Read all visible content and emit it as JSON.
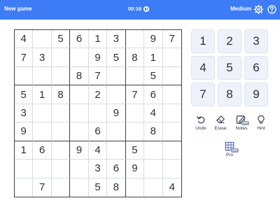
{
  "header": {
    "new_game_label": "New game",
    "timer": "00:16",
    "difficulty": "Medium",
    "accent_color": "#3d7cf5"
  },
  "board": {
    "grid": [
      [
        "4",
        "",
        "5",
        "6",
        "1",
        "3",
        "",
        "9",
        "7"
      ],
      [
        "7",
        "3",
        "",
        "",
        "9",
        "5",
        "8",
        "1",
        ""
      ],
      [
        "",
        "",
        "",
        "8",
        "7",
        "",
        "",
        "5",
        ""
      ],
      [
        "5",
        "1",
        "8",
        "",
        "2",
        "",
        "7",
        "6",
        ""
      ],
      [
        "3",
        "",
        "",
        "",
        "",
        "9",
        "",
        "4",
        ""
      ],
      [
        "9",
        "",
        "",
        "",
        "6",
        "",
        "",
        "8",
        ""
      ],
      [
        "1",
        "6",
        "",
        "9",
        "4",
        "",
        "5",
        "",
        ""
      ],
      [
        "",
        "",
        "",
        "",
        "3",
        "6",
        "9",
        "",
        ""
      ],
      [
        "",
        "7",
        "",
        "",
        "5",
        "8",
        "",
        "",
        "4"
      ]
    ]
  },
  "numpad": [
    "1",
    "2",
    "3",
    "4",
    "5",
    "6",
    "7",
    "8",
    "9"
  ],
  "tools": {
    "undo": "Undo",
    "erase": "Erase",
    "notes": "Notes",
    "notes_state": "OFF",
    "hint": "Hint",
    "pro": "Pro",
    "pro_state": "OFF"
  },
  "icons": [
    "pause-icon",
    "gear-icon",
    "help-icon",
    "undo-icon",
    "eraser-icon",
    "pencil-icon",
    "bulb-icon",
    "grid-icon"
  ]
}
